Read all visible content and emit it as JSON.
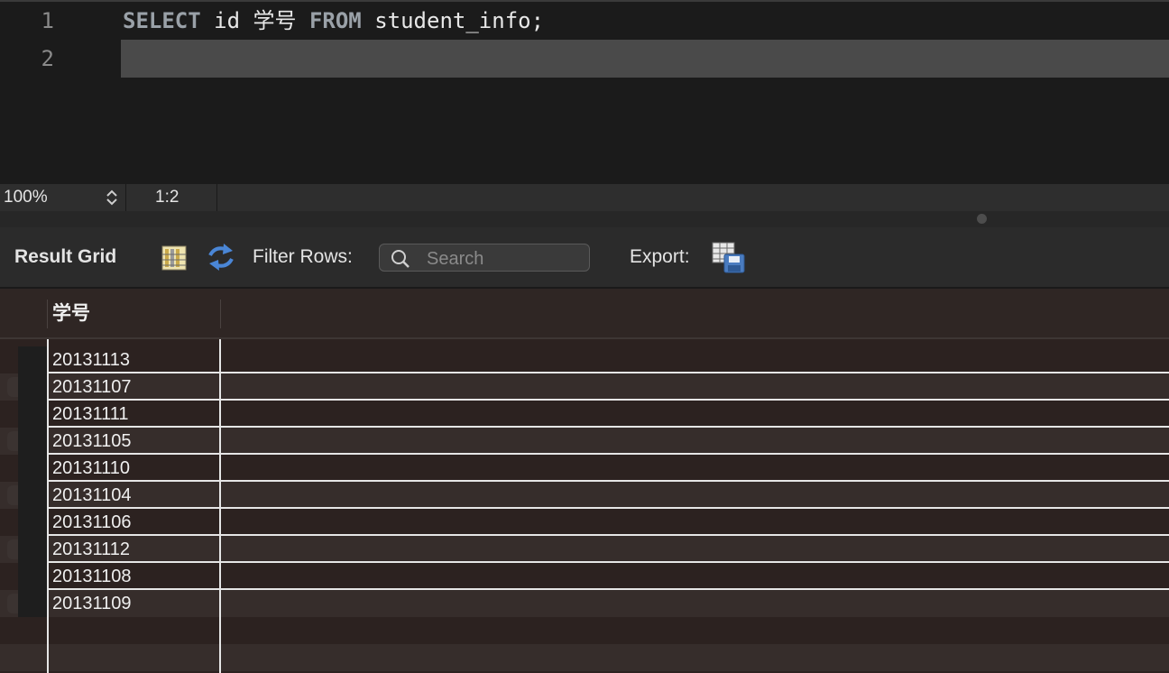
{
  "editor": {
    "lines": [
      {
        "number": "1",
        "kw1": "SELECT",
        "t1": " id 学号 ",
        "kw2": "FROM",
        "t2": " student_info;"
      },
      {
        "number": "2"
      }
    ]
  },
  "status": {
    "zoom": "100%",
    "cursor": "1:2"
  },
  "toolbar": {
    "result_grid": "Result Grid",
    "filter_rows": "Filter Rows:",
    "search_placeholder": "Search",
    "export": "Export:"
  },
  "grid": {
    "columns": [
      "学号"
    ],
    "rows": [
      "20131113",
      "20131107",
      "20131111",
      "20131105",
      "20131110",
      "20131104",
      "20131106",
      "20131112",
      "20131108",
      "20131109"
    ]
  },
  "colors": {
    "editor_bg": "#1b1b1b",
    "grid_bg": "#2c2220",
    "keyword": "#9aa1a8",
    "current_line": "#4a4a4a"
  }
}
